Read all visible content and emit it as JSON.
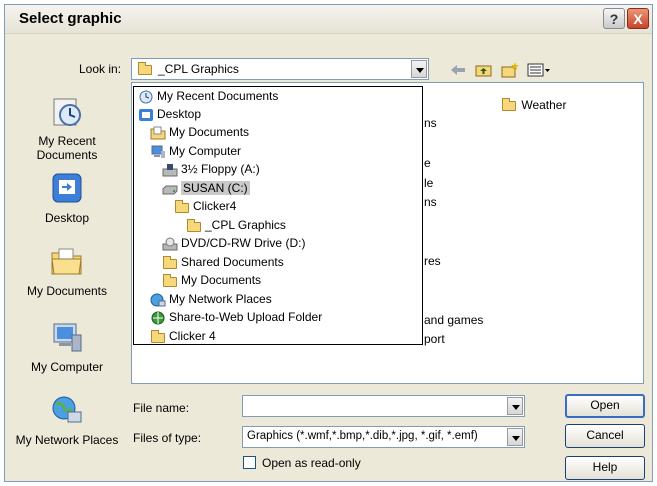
{
  "dialog": {
    "title": "Select graphic"
  },
  "title_buttons": {
    "help": "?",
    "close": "X"
  },
  "look_in": {
    "label": "Look in:",
    "value": "_CPL Graphics"
  },
  "places": [
    "My Recent Documents",
    "Desktop",
    "My Documents",
    "My Computer",
    "My Network Places"
  ],
  "dropdown_items": [
    "My Recent Documents",
    "Desktop",
    "My Documents",
    "My Computer",
    "3½ Floppy (A:)",
    "SUSAN (C:)",
    "Clicker4",
    "_CPL Graphics",
    "DVD/CD-RW Drive (D:)",
    "Shared Documents",
    "My Documents",
    "My Network Places",
    "Share-to-Web Upload Folder",
    "Clicker 4"
  ],
  "file_items": {
    "weather": "Weather",
    "partial": [
      "ns",
      "e",
      "le",
      "ns",
      "res",
      "and games",
      "port"
    ]
  },
  "file_name": {
    "label": "File name:",
    "value": ""
  },
  "files_of_type": {
    "label": "Files of type:",
    "value": "Graphics (*.wmf,*.bmp,*.dib,*.jpg, *.gif, *.emf)"
  },
  "read_only": {
    "label": "Open as read-only",
    "checked": false
  },
  "buttons": {
    "open": "Open",
    "cancel": "Cancel",
    "help": "Help"
  }
}
